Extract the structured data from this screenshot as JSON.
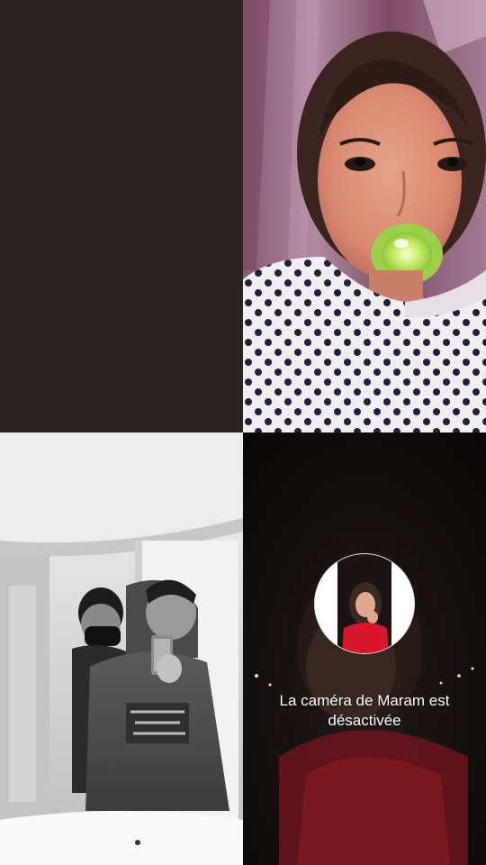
{
  "call": {
    "participants": [
      {
        "tile": 1,
        "video": "off-blank",
        "background": "#2a2220"
      },
      {
        "tile": 2,
        "video": "on"
      },
      {
        "tile": 3,
        "video": "on",
        "filter": "grayscale"
      },
      {
        "tile": 4,
        "video": "off",
        "overlay_text": "La caméra de Maram est désactivée"
      }
    ]
  },
  "colors": {
    "blank_tile": "#2a2220",
    "overlay_text": "#ffffff",
    "avatar_ring": "#ffffff",
    "dark_room": "#0d0a0a",
    "red_sweater": "#8a1a22"
  },
  "icons": {
    "avatar": "profile-photo-circle"
  }
}
